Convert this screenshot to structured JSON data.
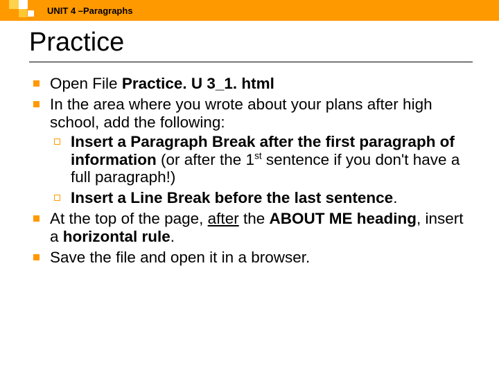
{
  "header": {
    "label": "UNIT 4 –Paragraphs"
  },
  "title": "Practice",
  "bullets": {
    "b1": {
      "pre": "Open File ",
      "bold": "Practice. U 3_1. html"
    },
    "b2": {
      "intro": "In the area where you wrote about your plans after high school, add the following:",
      "s1": {
        "bold_a": "Insert a Paragraph Break after the first paragraph of information",
        "tail_a": " (or after the 1",
        "sup": "st",
        "tail_b": " sentence if you don't have a full paragraph!)"
      },
      "s2": {
        "bold_a": "Insert a Line Break before the last sentence",
        "tail": "."
      }
    },
    "b3": {
      "a": "At the top of the page, ",
      "u": "after",
      "b": " the ",
      "bold1": "ABOUT ME heading",
      "c": ", insert a ",
      "bold2": "horizontal rule",
      "d": "."
    },
    "b4": "Save the file and open it in a browser."
  }
}
